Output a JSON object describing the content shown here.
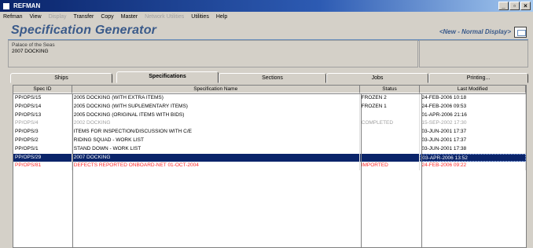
{
  "window": {
    "title": "REFMAN"
  },
  "menu": [
    {
      "label": "Refman",
      "disabled": false
    },
    {
      "label": "View",
      "disabled": false
    },
    {
      "label": "Display",
      "disabled": true
    },
    {
      "label": "Transfer",
      "disabled": false
    },
    {
      "label": "Copy",
      "disabled": false
    },
    {
      "label": "Master",
      "disabled": false
    },
    {
      "label": "Network Utilities",
      "disabled": true
    },
    {
      "label": "Utilities",
      "disabled": false
    },
    {
      "label": "Help",
      "disabled": false
    }
  ],
  "header": {
    "title": "Specification Generator",
    "mode": "<New - Normal Display>"
  },
  "context": {
    "label": "Palace of the Seas",
    "value": "2007 DOCKING"
  },
  "tabs": [
    {
      "label": "Ships",
      "active": false
    },
    {
      "label": "Specifications",
      "active": true
    },
    {
      "label": "Sections",
      "active": false
    },
    {
      "label": "Jobs",
      "active": false
    },
    {
      "label": "Printing...",
      "active": false
    }
  ],
  "table": {
    "columns": [
      "Spec ID",
      "Specification Name",
      "Status",
      "Last Modified"
    ],
    "rows": [
      {
        "id": "PP/OPS/15",
        "name": "2005 DOCKING        (WITH EXTRA ITEMS)",
        "status": "FROZEN 2",
        "modified": "24-FEB-2006 10:18",
        "style": "normal"
      },
      {
        "id": "PP/OPS/14",
        "name": "2005 DOCKING   (WITH SUPLEMENTARY ITEMS)",
        "status": "FROZEN 1",
        "modified": "24-FEB-2006 09:53",
        "style": "normal"
      },
      {
        "id": "PP/OPS/13",
        "name": "2005 DOCKING  (ORIGINAL ITEMS WITH BIDS)",
        "status": "",
        "modified": "01-APR-2006 21:16",
        "style": "normal"
      },
      {
        "id": "PP/OPS/4",
        "name": "2002 DOCKING",
        "status": "COMPLETED",
        "modified": "15-SEP-2002 17:30",
        "style": "dim"
      },
      {
        "id": "PP/OPS/3",
        "name": "ITEMS FOR INSPECTION/DISCUSSION WITH C/E",
        "status": "",
        "modified": "03-JUN-2001 17:37",
        "style": "normal"
      },
      {
        "id": "PP/OPS/2",
        "name": "RIDING SQUAD - WORK LIST",
        "status": "",
        "modified": "03-JUN-2001 17:37",
        "style": "normal"
      },
      {
        "id": "PP/OPS/1",
        "name": "STAND DOWN - WORK LIST",
        "status": "",
        "modified": "03-JUN-2001 17:38",
        "style": "normal"
      },
      {
        "id": "PP/OPS/29",
        "name": "2007 DOCKING",
        "status": "",
        "modified": "03-APR-2006 13:52",
        "style": "selected"
      },
      {
        "id": "PP/OPS/81",
        "name": "DEFECTS REPORTED ONBOARD-NET 01-OCT-2004",
        "status": "IMPORTED",
        "modified": "24-FEB-2006 09:22",
        "style": "red"
      }
    ]
  }
}
